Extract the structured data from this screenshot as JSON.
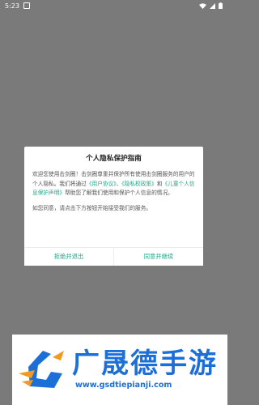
{
  "status_bar": {
    "time": "5:23"
  },
  "dialog": {
    "title": "个人隐私保护指南",
    "para1_before": "欢迎您使用击剑圈！击剑圈尊重并保护所有使用击剑圈服务的用户的个人隐私。我们将通过",
    "link_user_agreement": "《用户协议》",
    "sep1": "、",
    "link_privacy_policy": "《隐私权政策》",
    "sep2": "和",
    "link_child_policy": "《儿童个人信息保护声明》",
    "para1_after": "帮助您了解我们使用和保护个人信息的情况。",
    "para2": "如您同意，请点击下方按钮开始接受我们的服务。",
    "reject_label": "拒绝并退出",
    "accept_label": "同意并继续"
  },
  "footer": {
    "brand_name": "广晟德手游",
    "url": "www.gsdtiepianji.com"
  },
  "colors": {
    "accent": "#22a78a",
    "brand": "#1d6fd8"
  }
}
